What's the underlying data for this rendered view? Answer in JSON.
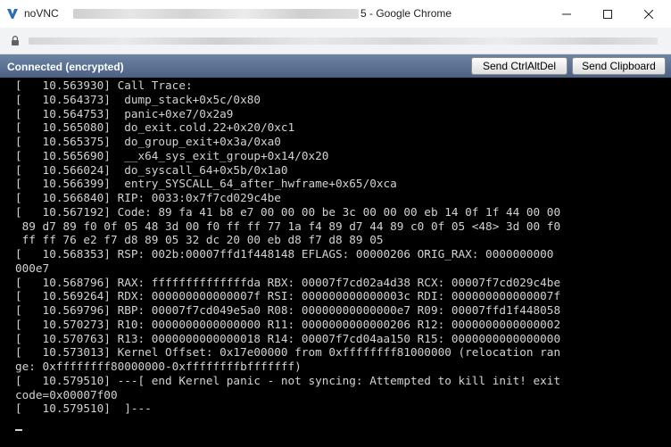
{
  "window": {
    "title_prefix": "noVNC",
    "title_suffix": "5 - Google Chrome",
    "icons": {
      "app": "novnc-logo-icon",
      "minimize": "minimize-icon",
      "maximize": "maximize-icon",
      "close": "close-icon"
    }
  },
  "address_bar": {
    "icon": "lock-icon"
  },
  "vnc_bar": {
    "status": "Connected (encrypted)",
    "send_ctrl_alt_del": "Send CtrlAltDel",
    "send_clipboard": "Send Clipboard",
    "bar_color": "#4a6184"
  },
  "terminal": {
    "lines": [
      "[   10.563930] Call Trace:",
      "[   10.564373]  dump_stack+0x5c/0x80",
      "[   10.564753]  panic+0xe7/0x2a9",
      "[   10.565080]  do_exit.cold.22+0x20/0xc1",
      "[   10.565375]  do_group_exit+0x3a/0xa0",
      "[   10.565690]  __x64_sys_exit_group+0x14/0x20",
      "[   10.566024]  do_syscall_64+0x5b/0x1a0",
      "[   10.566399]  entry_SYSCALL_64_after_hwframe+0x65/0xca",
      "[   10.566840] RIP: 0033:0x7f7cd029c4be",
      "[   10.567192] Code: 89 fa 41 b8 e7 00 00 00 be 3c 00 00 00 eb 14 0f 1f 44 00 00",
      " 89 d7 89 f0 0f 05 48 3d 00 f0 ff ff 77 1a f4 89 d7 44 89 c0 0f 05 <48> 3d 00 f0",
      " ff ff 76 e2 f7 d8 89 05 32 dc 20 00 eb d8 f7 d8 89 05",
      "[   10.568353] RSP: 002b:00007ffd1f448148 EFLAGS: 00000206 ORIG_RAX: 0000000000",
      "000e7",
      "[   10.568796] RAX: ffffffffffffffda RBX: 00007f7cd02a4d38 RCX: 00007f7cd029c4be",
      "[   10.569264] RDX: 000000000000007f RSI: 000000000000003c RDI: 000000000000007f",
      "[   10.569796] RBP: 00007f7cd049e5a0 R08: 00000000000000e7 R09: 00007ffd1f448058",
      "[   10.570273] R10: 0000000000000000 R11: 0000000000000206 R12: 0000000000000002",
      "[   10.570763] R13: 0000000000000018 R14: 00007f7cd04aa150 R15: 0000000000000000",
      "[   10.573013] Kernel Offset: 0x17e00000 from 0xffffffff81000000 (relocation ran",
      "ge: 0xffffffff80000000-0xffffffffbfffffff)",
      "[   10.579510] ---[ end Kernel panic - not syncing: Attempted to kill init! exit",
      "code=0x00007f00",
      "[   10.579510]  ]---"
    ]
  }
}
